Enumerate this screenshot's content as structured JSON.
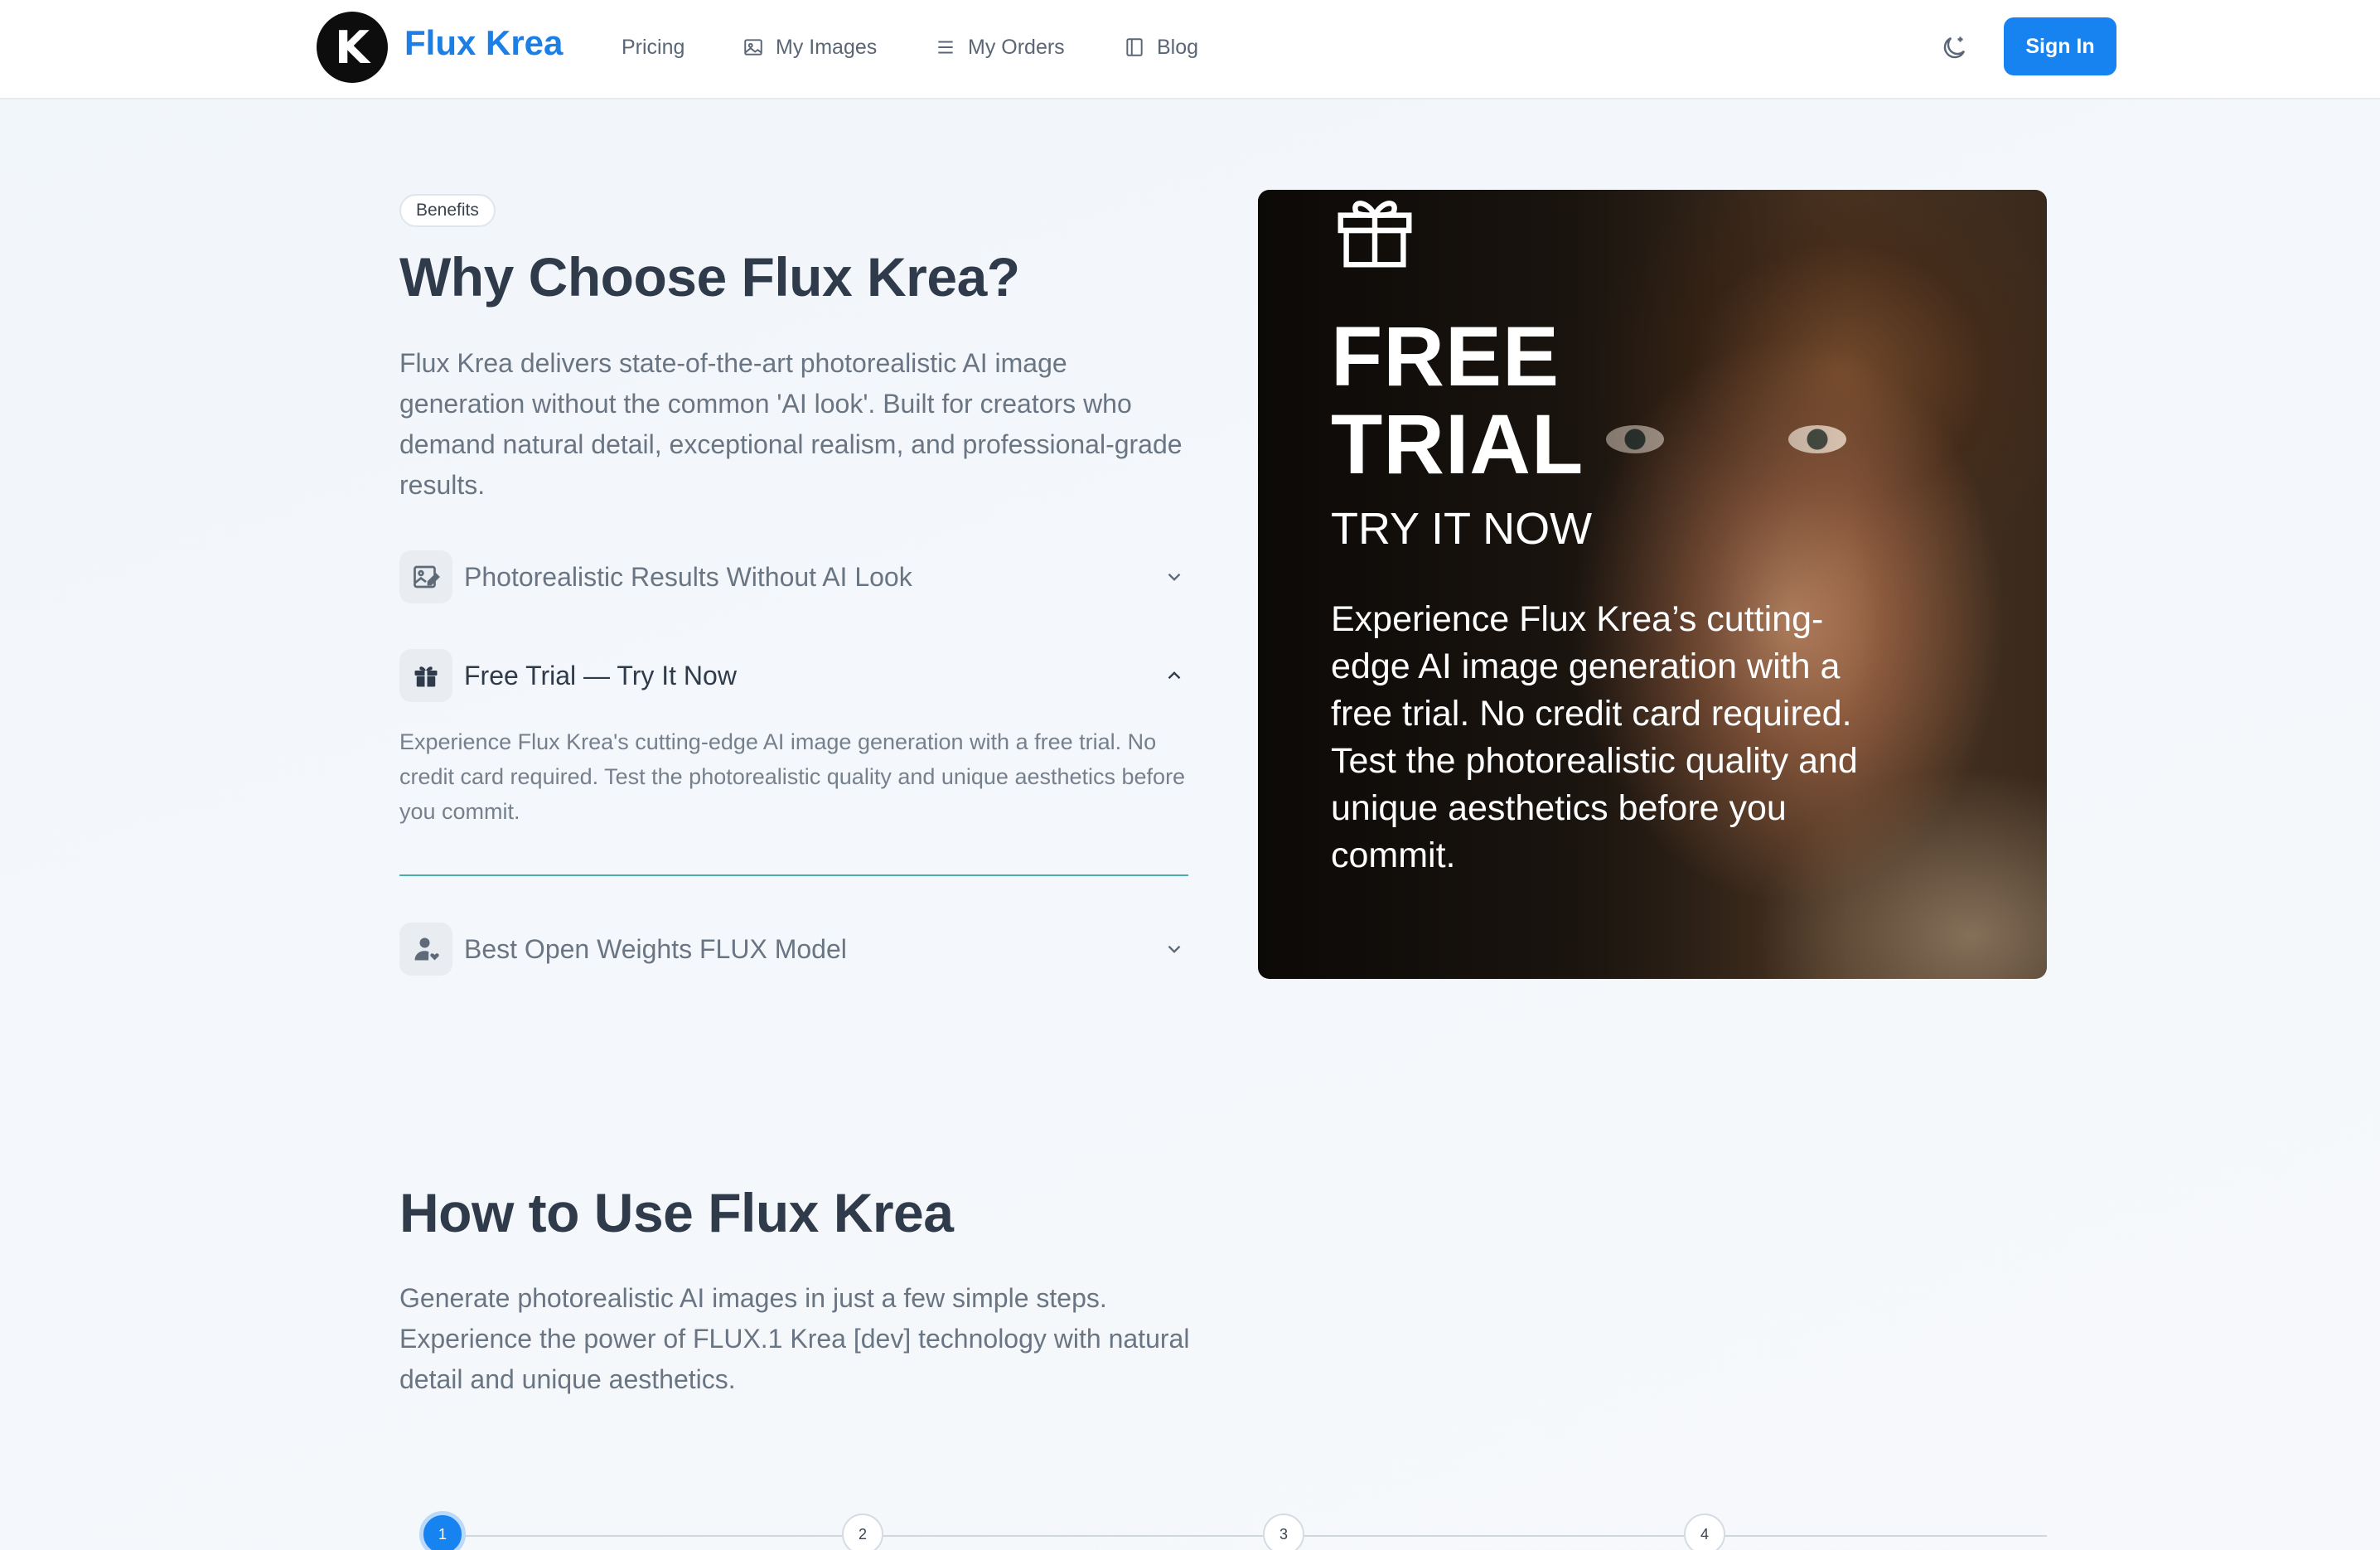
{
  "header": {
    "logo_letter": "K",
    "brand": "Flux Krea",
    "nav": [
      {
        "label": "Pricing",
        "icon": ""
      },
      {
        "label": "My Images",
        "icon": "image-icon"
      },
      {
        "label": "My Orders",
        "icon": "list-icon"
      },
      {
        "label": "Blog",
        "icon": "book-icon"
      }
    ],
    "theme_toggle_icon": "moon-icon",
    "signin_label": "Sign In"
  },
  "benefits": {
    "badge": "Benefits",
    "title": "Why Choose Flux Krea?",
    "intro": "Flux Krea delivers state-of-the-art photorealistic AI image generation without the common 'AI look'. Built for creators who demand natural detail, exceptional realism, and professional-grade results.",
    "items": [
      {
        "title": "Photorealistic Results Without AI Look",
        "icon": "image-edit-icon",
        "open": false
      },
      {
        "title": "Free Trial — Try It Now",
        "icon": "gift-icon",
        "open": true,
        "body": "Experience Flux Krea's cutting-edge AI image generation with a free trial. No credit card required. Test the photorealistic quality and unique aesthetics before you commit."
      },
      {
        "title": "Best Open Weights FLUX Model",
        "icon": "user-heart-icon",
        "open": false
      }
    ]
  },
  "promo": {
    "line1": "FREE",
    "line2": "TRIAL",
    "sub": "TRY IT NOW",
    "text": "Experience Flux Krea’s cutting-edge AI image generation with a free trial. No credit card required. Test the photorealistic quality and unique aesthetics before you commit.",
    "icon": "gift-icon"
  },
  "how_to": {
    "title": "How to Use Flux Krea",
    "intro": "Generate photorealistic AI images in just a few simple steps. Experience the power of FLUX.1 Krea [dev] technology with natural detail and unique aesthetics.",
    "steps": [
      "1",
      "2",
      "3",
      "4"
    ],
    "active_step": 1
  },
  "colors": {
    "accent": "#1683f0",
    "brand": "#1b7fe6",
    "divider": "#47b0ad"
  }
}
